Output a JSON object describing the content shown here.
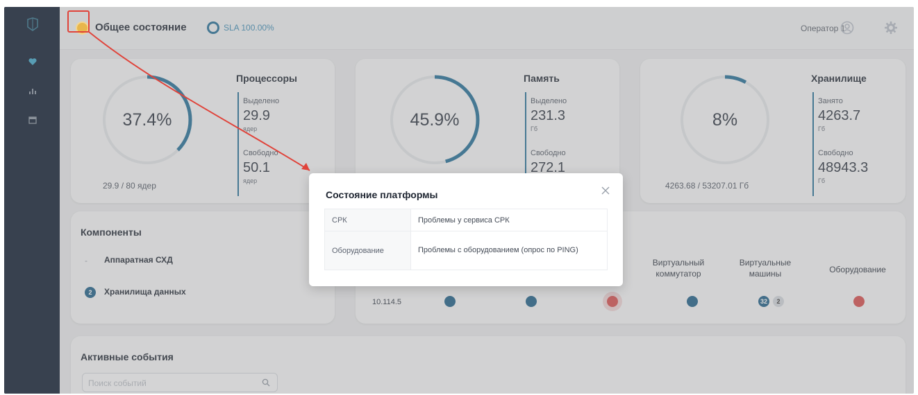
{
  "topbar": {
    "title": "Общее состояние",
    "sla": "SLA 100.00%",
    "operator": "Оператор 1"
  },
  "cpu": {
    "percent": "37.4%",
    "fraction": 0.374,
    "summary": "29.9 / 80 ядер",
    "title": "Процессоры",
    "allocated_label": "Выделено",
    "allocated_value": "29.9",
    "allocated_unit": "ядер",
    "free_label": "Свободно",
    "free_value": "50.1",
    "free_unit": "ядер"
  },
  "memory": {
    "percent": "45.9%",
    "fraction": 0.459,
    "title": "Память",
    "allocated_label": "Выделено",
    "allocated_value": "231.3",
    "allocated_unit": "Гб",
    "free_label": "Свободно",
    "free_value": "272.1"
  },
  "storage": {
    "percent": "8%",
    "fraction": 0.08,
    "summary": "4263.68 / 53207.01 Гб",
    "title": "Хранилище",
    "used_label": "Занято",
    "used_value": "4263.7",
    "used_unit": "Гб",
    "free_label": "Свободно",
    "free_value": "48943.3",
    "free_unit": "Гб"
  },
  "components": {
    "title": "Компоненты",
    "items": [
      {
        "label": "Аппаратная СХД",
        "badge": ""
      },
      {
        "label": "Хранилища данных",
        "badge": "2"
      }
    ]
  },
  "grid": {
    "columns": [
      "Виртуальный коммутатор",
      "Виртуальные машины",
      "Оборудование"
    ],
    "row_ip": "10.114.5",
    "vm_badges": [
      "32",
      "2"
    ]
  },
  "events": {
    "title": "Активные события",
    "search_placeholder": "Поиск событий"
  },
  "modal": {
    "title": "Состояние платформы",
    "rows": [
      {
        "key": "СРК",
        "value": "Проблемы у сервиса СРК"
      },
      {
        "key": "Оборудование",
        "value": "Проблемы с оборудованием (опрос по PING)"
      }
    ]
  },
  "colors": {
    "sidebar": "#0c1a2e",
    "accent": "#216d97",
    "status_warning": "#e8b64c",
    "error": "#d84c4c",
    "annotation": "#e0433a"
  },
  "icons": [
    "logo-icon",
    "heart-icon",
    "chart-icon",
    "calendar-icon",
    "user-icon",
    "gear-icon",
    "close-icon",
    "search-icon",
    "check-icon",
    "x-icon"
  ]
}
